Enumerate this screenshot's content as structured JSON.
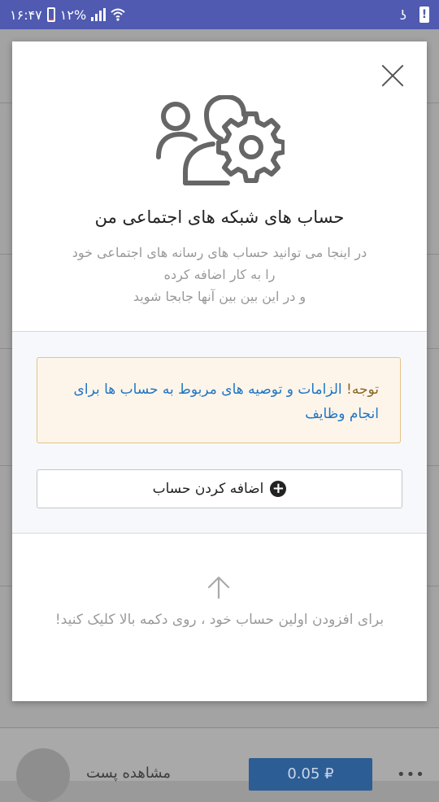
{
  "status_bar": {
    "time": "۱۶:۴۷",
    "battery": "۱۲%",
    "battery_level": 0.12,
    "notification_glyph": "ʖ",
    "alert_glyph": "!"
  },
  "background": {
    "item_label": "مشاهده پست",
    "item_price": "0.05 ₽",
    "more_glyph": "•••"
  },
  "dialog": {
    "title": "حساب های شبکه های اجتماعی من",
    "description_lines": [
      "در اینجا می توانید حساب های رسانه های اجتماعی خود",
      "را به کار اضافه کرده",
      "و در این بین بین آنها جابجا شوید"
    ],
    "notice": {
      "label": "توجه!",
      "link": "الزامات و توصیه های مربوط به حساب ها برای انجام وظایف"
    },
    "add_button_label": "اضافه کردن حساب",
    "hint": "برای افزودن اولین حساب خود ، روی دکمه بالا کلیک کنید!"
  },
  "icons": {
    "hero": "users-gear-icon",
    "close": "close-icon",
    "add": "plus-circle-icon",
    "arrow": "arrow-up-icon",
    "signal": "signal-icon",
    "wifi": "wifi-icon",
    "battery": "battery-icon"
  },
  "colors": {
    "status_bar": "#4f5ab0",
    "link": "#1f75c4",
    "notice_bg": "#fdf5ea",
    "notice_border": "#e6c288",
    "price_button": "#2d5d95"
  }
}
